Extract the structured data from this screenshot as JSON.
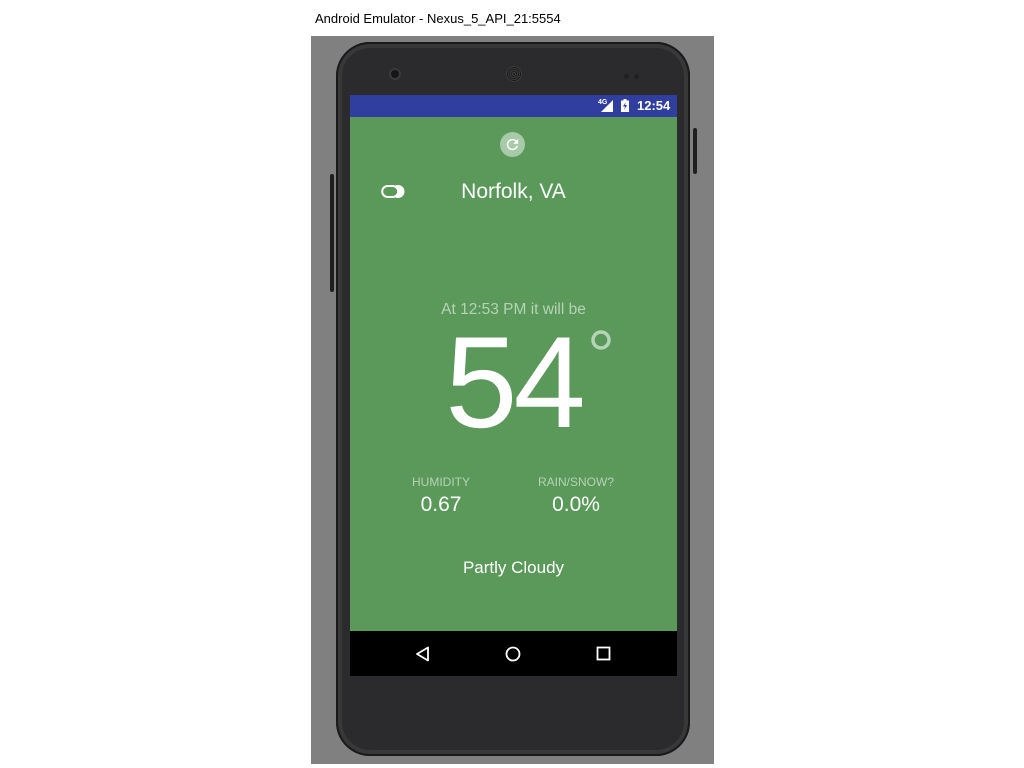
{
  "window": {
    "title": "Android Emulator - Nexus_5_API_21:5554"
  },
  "status_bar": {
    "network": "4G",
    "time": "12:54",
    "color": "#303f9f"
  },
  "weather": {
    "location": "Norfolk, VA",
    "time_label": "At 12:53 PM it will be",
    "temperature": "54",
    "humidity_label": "HUMIDITY",
    "humidity_value": "0.67",
    "precip_label": "RAIN/SNOW?",
    "precip_value": "0.0%",
    "summary": "Partly Cloudy",
    "icon": "partly-cloudy-icon",
    "background_color": "#5a995a"
  },
  "nav_bar": {
    "icons": [
      "back-icon",
      "home-icon",
      "recents-icon"
    ]
  }
}
